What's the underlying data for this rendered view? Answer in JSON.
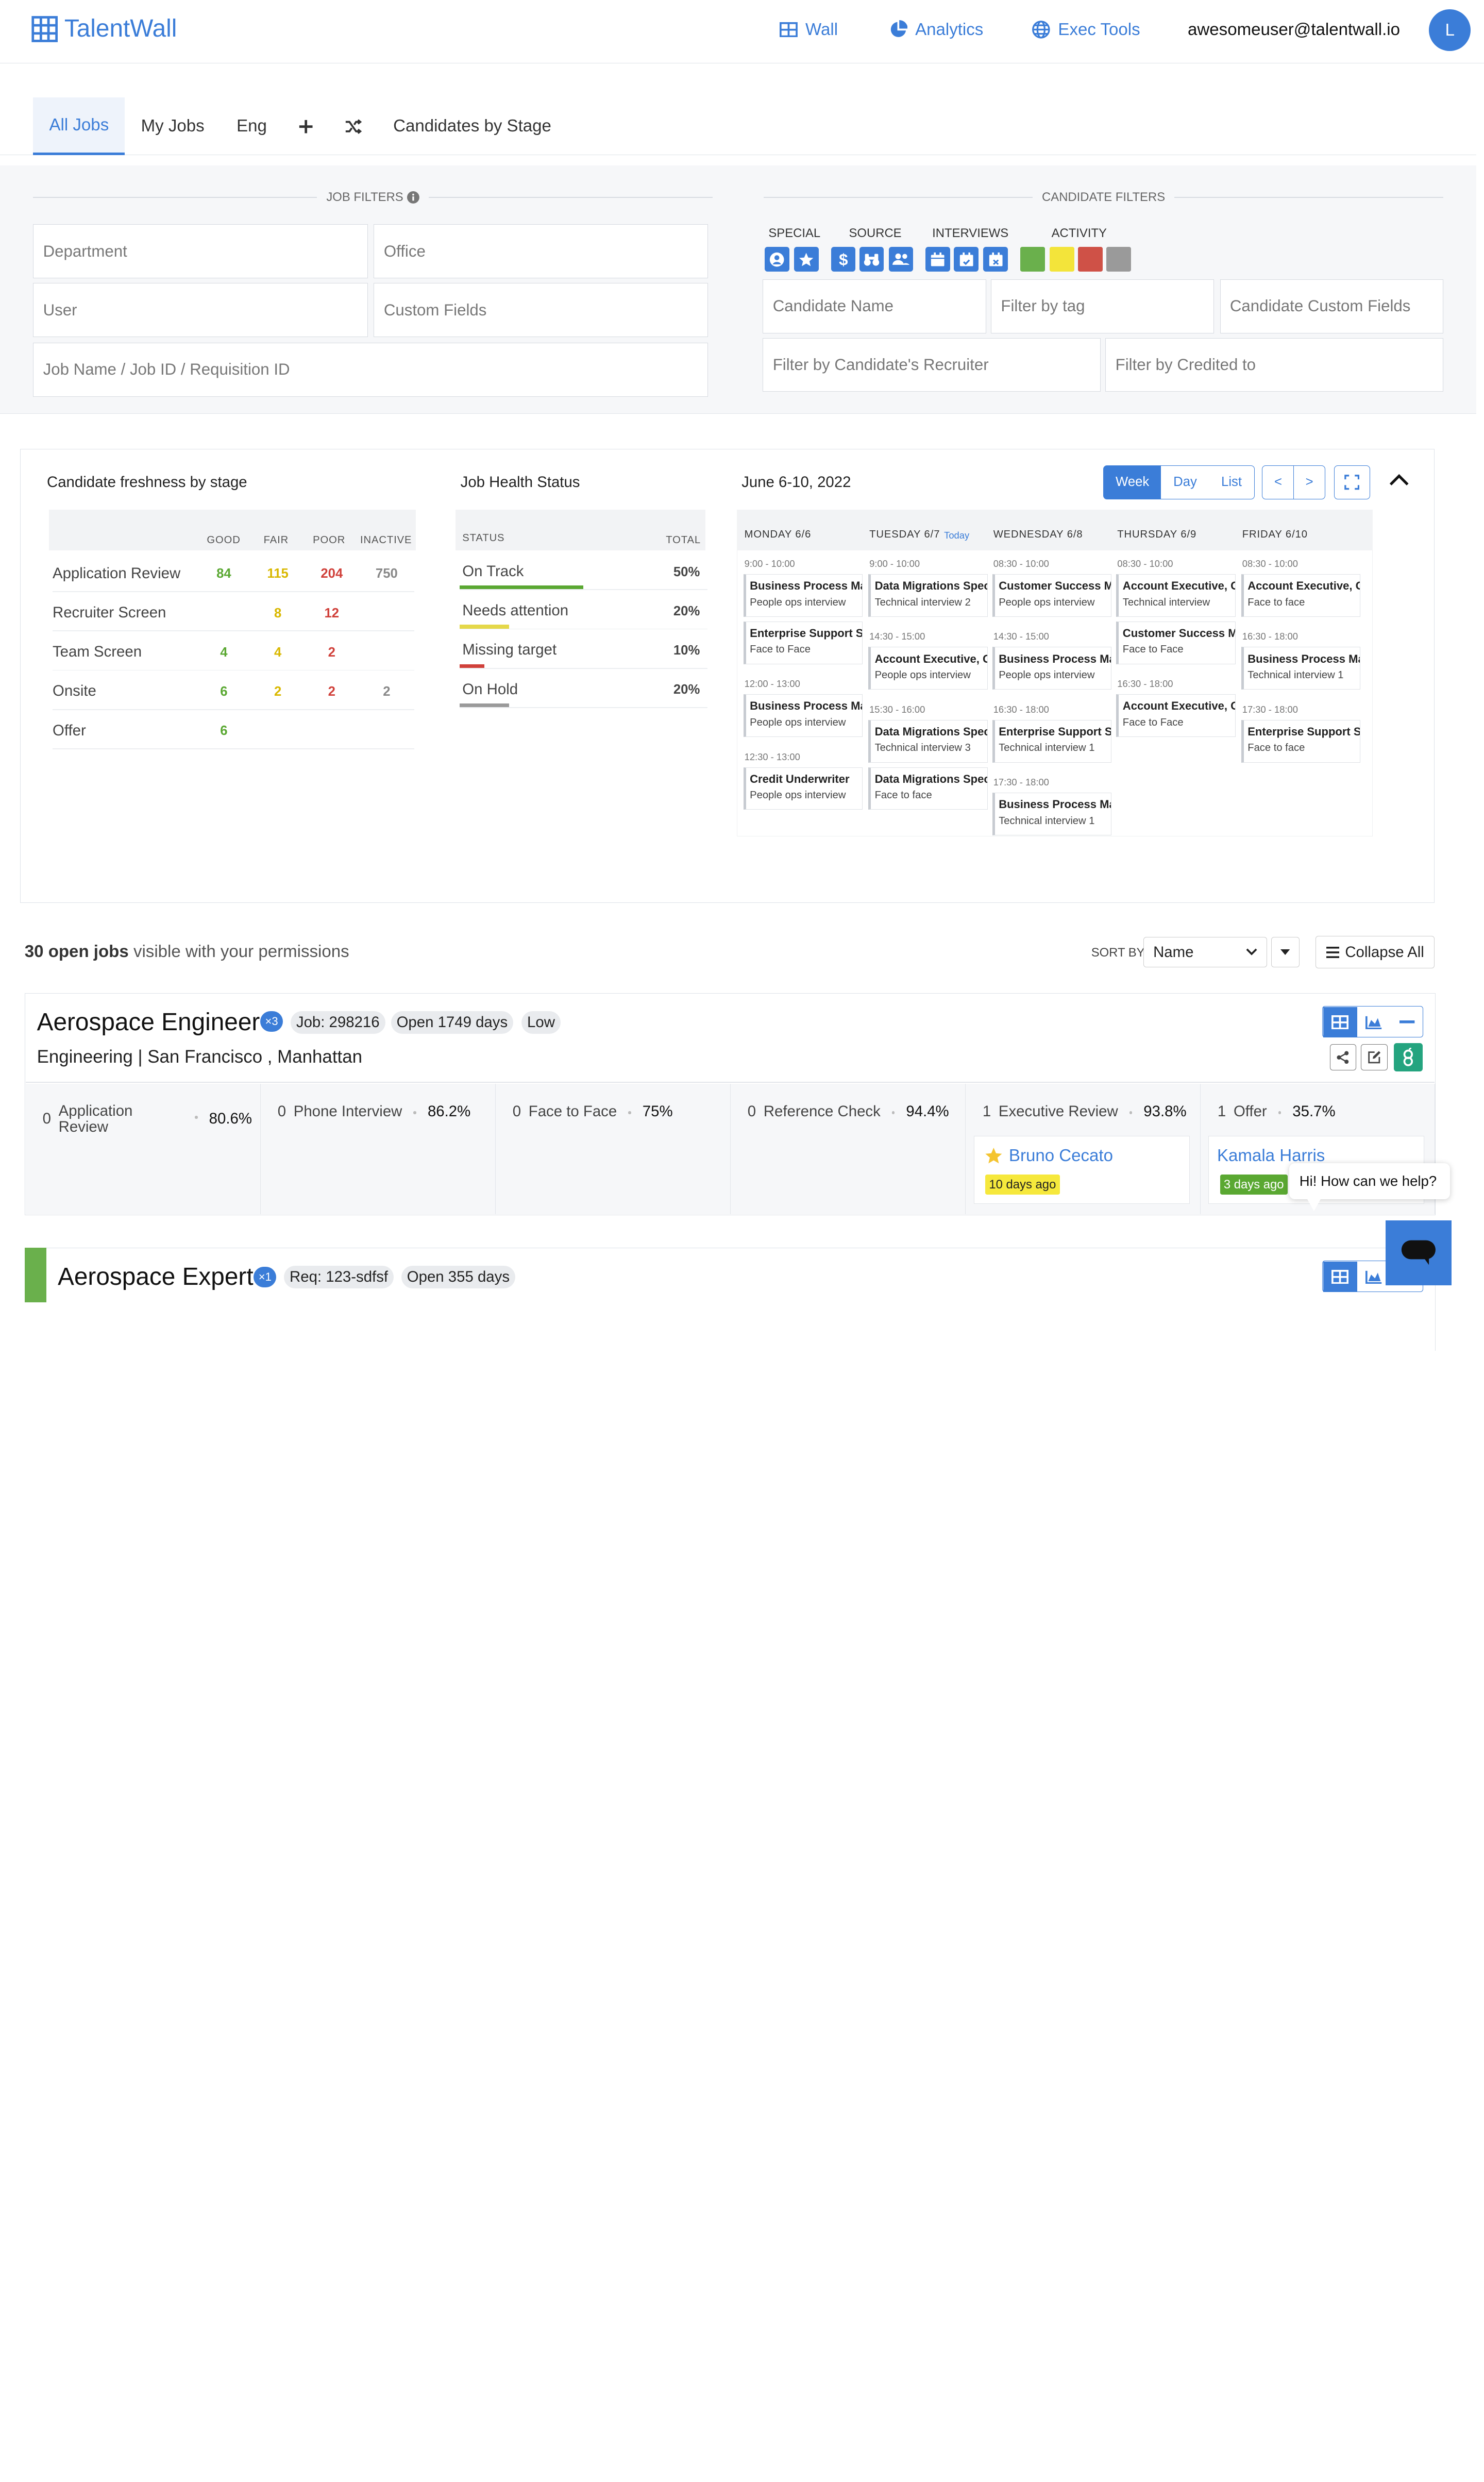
{
  "app": {
    "name": "TalentWall",
    "brand_color": "#3b7dd8"
  },
  "nav": {
    "items": [
      {
        "label": "Wall",
        "icon": "grid-icon"
      },
      {
        "label": "Analytics",
        "icon": "pie-chart-icon"
      },
      {
        "label": "Exec Tools",
        "icon": "globe-icon"
      }
    ],
    "user_email": "awesomeuser@talentwall.io",
    "avatar_initial": "L"
  },
  "tabs": {
    "items": [
      {
        "label": "All Jobs",
        "active": true
      },
      {
        "label": "My Jobs"
      },
      {
        "label": "Eng"
      },
      {
        "label": "Candidates by Stage"
      }
    ],
    "add_icon": "plus-icon",
    "shuffle_icon": "shuffle-icon"
  },
  "job_filters": {
    "heading": "JOB FILTERS",
    "department": "Department",
    "office": "Office",
    "user": "User",
    "custom_fields": "Custom Fields",
    "job_name": "Job Name / Job ID / Requisition ID"
  },
  "candidate_filters": {
    "heading": "CANDIDATE FILTERS",
    "groups": [
      "SPECIAL",
      "SOURCE",
      "INTERVIEWS",
      "ACTIVITY"
    ],
    "activity_colors": [
      "#6ab04c",
      "#f3e43a",
      "#cf5147",
      "#9a9a9a"
    ],
    "candidate_name": "Candidate Name",
    "tag": "Filter by tag",
    "custom_fields": "Candidate Custom Fields",
    "recruiter": "Filter by Candidate's Recruiter",
    "credited": "Filter by Credited to"
  },
  "freshness": {
    "title": "Candidate freshness by stage",
    "columns": [
      "GOOD",
      "FAIR",
      "POOR",
      "INACTIVE"
    ],
    "colors": {
      "good": "#5aa832",
      "fair": "#d9b800",
      "poor": "#d0403a",
      "inactive": "#888888"
    },
    "rows": [
      {
        "stage": "Application Review",
        "good": "84",
        "fair": "115",
        "poor": "204",
        "inactive": "750"
      },
      {
        "stage": "Recruiter Screen",
        "good": "",
        "fair": "8",
        "poor": "12",
        "inactive": ""
      },
      {
        "stage": "Team Screen",
        "good": "4",
        "fair": "4",
        "poor": "2",
        "inactive": ""
      },
      {
        "stage": "Onsite",
        "good": "6",
        "fair": "2",
        "poor": "2",
        "inactive": "2"
      },
      {
        "stage": "Offer",
        "good": "6",
        "fair": "",
        "poor": "",
        "inactive": ""
      }
    ]
  },
  "job_health": {
    "title": "Job Health Status",
    "status_header": "STATUS",
    "total_header": "TOTAL",
    "rows": [
      {
        "label": "On Track",
        "value": "50%",
        "fraction": 0.5,
        "color": "#5aa832"
      },
      {
        "label": "Needs attention",
        "value": "20%",
        "fraction": 0.2,
        "color": "#e5d84a"
      },
      {
        "label": "Missing target",
        "value": "10%",
        "fraction": 0.1,
        "color": "#d0403a"
      },
      {
        "label": "On Hold",
        "value": "20%",
        "fraction": 0.2,
        "color": "#9a9a9a"
      }
    ]
  },
  "calendar": {
    "title": "June 6-10, 2022",
    "views": [
      "Week",
      "Day",
      "List"
    ],
    "prev": "<",
    "next": ">",
    "today_label": "Today",
    "days": [
      {
        "label": "MONDAY 6/6"
      },
      {
        "label": "TUESDAY 6/7",
        "today": true
      },
      {
        "label": "WEDNESDAY 6/8"
      },
      {
        "label": "THURSDAY 6/9"
      },
      {
        "label": "FRIDAY 6/10"
      }
    ],
    "times": [
      "9:00 - 10:00",
      "12:00 - 13:00",
      "12:30 - 13:00",
      "9:00 - 10:00",
      "14:30 - 15:00",
      "15:30 - 16:00",
      "08:30 - 10:00",
      "14:30 - 15:00",
      "16:30 - 18:00",
      "17:30 - 18:00",
      "08:30 - 10:00",
      "16:30 - 18:00",
      "08:30 - 10:00",
      "16:30 - 18:00",
      "17:30 - 18:00"
    ],
    "events": [
      {
        "title": "Business Process Man",
        "type": "People ops interview"
      },
      {
        "title": "Enterprise Support Sp",
        "type": "Face to Face"
      },
      {
        "title": "Business Process Man",
        "type": "People ops interview"
      },
      {
        "title": "Credit Underwriter",
        "type": "People ops interview"
      },
      {
        "title": "Data Migrations Speci",
        "type": "Technical interview 2"
      },
      {
        "title": "Account Executive, Gr",
        "type": "People ops interview"
      },
      {
        "title": "Data Migrations Speci",
        "type": "Technical interview 3"
      },
      {
        "title": "Data Migrations Speci",
        "type": "Face to face"
      },
      {
        "title": "Customer Success Ma",
        "type": "People ops interview"
      },
      {
        "title": "Business Process Man",
        "type": "People ops interview"
      },
      {
        "title": "Enterprise Support Sp",
        "type": "Technical interview 1"
      },
      {
        "title": "Business Process Man",
        "type": "Technical interview 1"
      },
      {
        "title": "Account Executive, Gr",
        "type": "Technical interview"
      },
      {
        "title": "Customer Success Ma",
        "type": "Face to Face"
      },
      {
        "title": "Account Executive, Gr",
        "type": "Face to Face"
      },
      {
        "title": "Account Executive, Gr",
        "type": "Face to face"
      },
      {
        "title": "Business Process Man",
        "type": "Technical interview 1"
      },
      {
        "title": "Enterprise Support Sp",
        "type": "Face to face"
      }
    ]
  },
  "jobs_list": {
    "count": "30 open jobs",
    "count_suffix": "visible with your permissions",
    "sort_label": "SORT BY",
    "sort_value": "Name",
    "collapse_all": "Collapse All",
    "jobs": [
      {
        "title": "Aerospace Engineer",
        "count_badge": "×3",
        "job_id": "Job: 298216",
        "open_days": "Open 1749 days",
        "priority": "Low",
        "department_line": "Engineering | San Francisco , Manhattan",
        "stages": [
          {
            "count": "0",
            "name": "Application Review",
            "pct": "80.6%"
          },
          {
            "count": "0",
            "name": "Phone Interview",
            "pct": "86.2%"
          },
          {
            "count": "0",
            "name": "Face to Face",
            "pct": "75%"
          },
          {
            "count": "0",
            "name": "Reference Check",
            "pct": "94.4%"
          },
          {
            "count": "1",
            "name": "Executive Review",
            "pct": "93.8%"
          },
          {
            "count": "1",
            "name": "Offer",
            "pct": "35.7%"
          }
        ],
        "candidates": [
          {
            "name": "Bruno Cecato",
            "age": "10 days ago",
            "starred": true
          },
          {
            "name": "Kamala Harris",
            "age": "3 days ago"
          }
        ]
      },
      {
        "title": "Aerospace Expert",
        "count_badge": "×1",
        "req_id": "Req: 123-sdfsf",
        "open_days": "Open 355 days",
        "status_color": "#6ab04c"
      }
    ]
  },
  "chat": {
    "bubble": "Hi! How can we help?"
  }
}
